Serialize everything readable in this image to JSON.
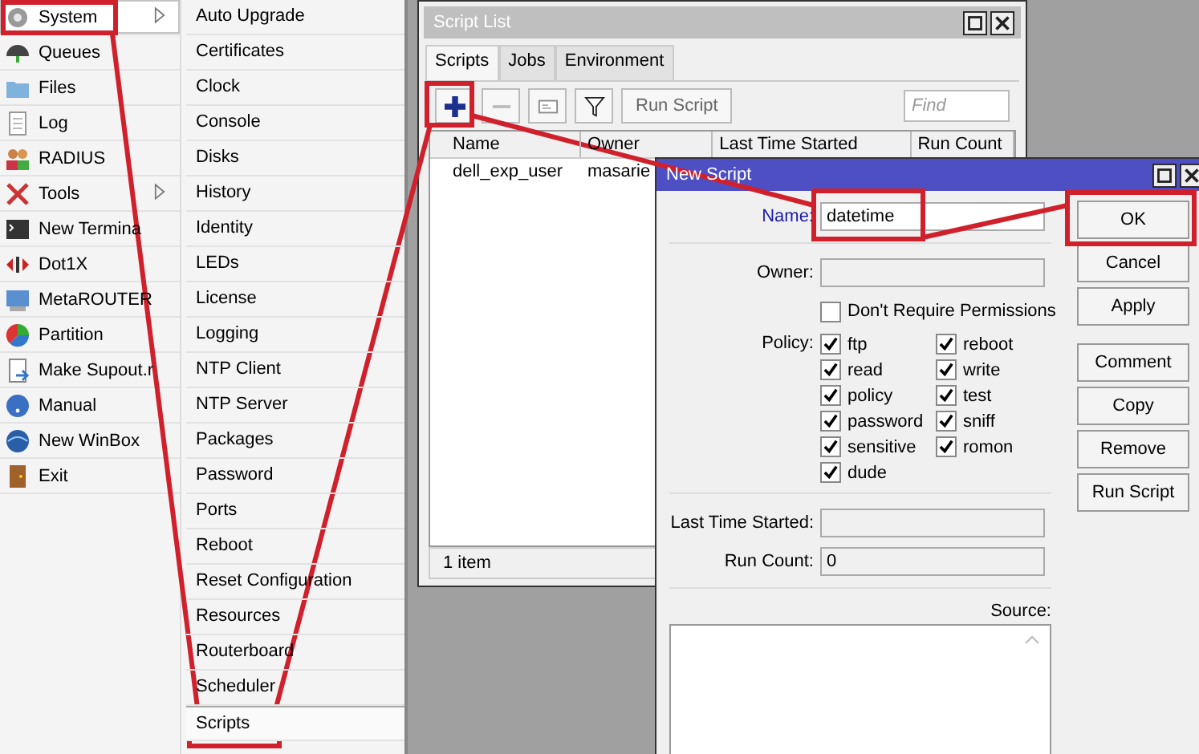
{
  "main_menu": {
    "items": [
      {
        "label": "System",
        "submenu": true,
        "selected": true
      },
      {
        "label": "Queues",
        "submenu": false,
        "selected": false
      },
      {
        "label": "Files",
        "submenu": false,
        "selected": false
      },
      {
        "label": "Log",
        "submenu": false,
        "selected": false
      },
      {
        "label": "RADIUS",
        "submenu": false,
        "selected": false
      },
      {
        "label": "Tools",
        "submenu": true,
        "selected": false
      },
      {
        "label": "New Termina",
        "submenu": false,
        "selected": false
      },
      {
        "label": "Dot1X",
        "submenu": false,
        "selected": false
      },
      {
        "label": "MetaROUTER",
        "submenu": false,
        "selected": false
      },
      {
        "label": "Partition",
        "submenu": false,
        "selected": false
      },
      {
        "label": "Make Supout.r",
        "submenu": false,
        "selected": false
      },
      {
        "label": "Manual",
        "submenu": false,
        "selected": false
      },
      {
        "label": "New WinBox",
        "submenu": false,
        "selected": false
      },
      {
        "label": "Exit",
        "submenu": false,
        "selected": false
      }
    ]
  },
  "system_submenu": {
    "items": [
      {
        "label": "Auto Upgrade",
        "selected": false
      },
      {
        "label": "Certificates",
        "selected": false
      },
      {
        "label": "Clock",
        "selected": false
      },
      {
        "label": "Console",
        "selected": false
      },
      {
        "label": "Disks",
        "selected": false
      },
      {
        "label": "History",
        "selected": false
      },
      {
        "label": "Identity",
        "selected": false
      },
      {
        "label": "LEDs",
        "selected": false
      },
      {
        "label": "License",
        "selected": false
      },
      {
        "label": "Logging",
        "selected": false
      },
      {
        "label": "NTP Client",
        "selected": false
      },
      {
        "label": "NTP Server",
        "selected": false
      },
      {
        "label": "Packages",
        "selected": false
      },
      {
        "label": "Password",
        "selected": false
      },
      {
        "label": "Ports",
        "selected": false
      },
      {
        "label": "Reboot",
        "selected": false
      },
      {
        "label": "Reset Configuration",
        "selected": false
      },
      {
        "label": "Resources",
        "selected": false
      },
      {
        "label": "Routerboard",
        "selected": false
      },
      {
        "label": "Scheduler",
        "selected": false
      },
      {
        "label": "Scripts",
        "selected": true
      }
    ]
  },
  "script_list": {
    "title": "Script List",
    "tabs": [
      {
        "label": "Scripts",
        "selected": true
      },
      {
        "label": "Jobs",
        "selected": false
      },
      {
        "label": "Environment",
        "selected": false
      }
    ],
    "run_button": "Run Script",
    "find": {
      "placeholder": "Find"
    },
    "table": {
      "columns": [
        "Name",
        "Owner",
        "Last Time Started",
        "Run Count"
      ],
      "rows": [
        [
          "dell_exp_user",
          "masarie"
        ]
      ]
    },
    "status_bar": "1 item"
  },
  "new_script": {
    "title": "New Script",
    "name": {
      "label": "Name:",
      "value": "datetime"
    },
    "owner": {
      "label": "Owner:"
    },
    "dont_require_permissions": {
      "label": "Don't Require Permissions",
      "checked": false
    },
    "policy_label": "Policy:",
    "policies": [
      {
        "label": "ftp",
        "checked": true
      },
      {
        "label": "reboot",
        "checked": true
      },
      {
        "label": "read",
        "checked": true
      },
      {
        "label": "write",
        "checked": true
      },
      {
        "label": "policy",
        "checked": true
      },
      {
        "label": "test",
        "checked": true
      },
      {
        "label": "password",
        "checked": true
      },
      {
        "label": "sniff",
        "checked": true
      },
      {
        "label": "sensitive",
        "checked": true
      },
      {
        "label": "romon",
        "checked": true
      },
      {
        "label": "dude",
        "checked": true
      }
    ],
    "last_time_started": {
      "label": "Last Time Started:"
    },
    "run_count": {
      "label": "Run Count:",
      "value": "0"
    },
    "source": {
      "label": "Source:"
    },
    "buttons": [
      {
        "label": "OK"
      },
      {
        "label": "Cancel"
      },
      {
        "label": "Apply"
      },
      {
        "label": "Comment"
      },
      {
        "label": "Copy"
      },
      {
        "label": "Remove"
      },
      {
        "label": "Run Script"
      }
    ]
  }
}
